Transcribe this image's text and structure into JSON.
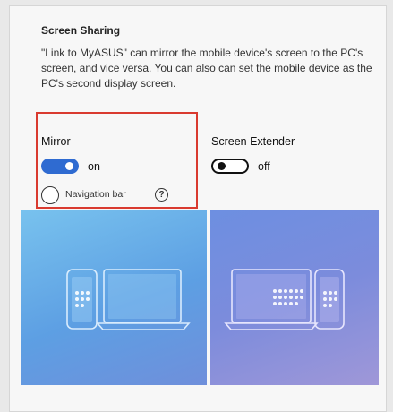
{
  "section": {
    "title": "Screen Sharing",
    "description": "\"Link to MyASUS\" can mirror the mobile device's screen to the PC's screen, and vice versa. You can also can set the mobile device as the PC's second display screen."
  },
  "mirror": {
    "label": "Mirror",
    "toggle_state": "on",
    "navigation_bar_label": "Navigation bar",
    "help_glyph": "?"
  },
  "screen_extender": {
    "label": "Screen Extender",
    "toggle_state": "off"
  },
  "icons": {
    "help": "help-circle-icon",
    "mirror_preview": "phone-laptop-mirror-illustration",
    "extender_preview": "laptop-phone-extend-illustration"
  },
  "colors": {
    "toggle_on": "#2f6bd1",
    "highlight_border": "#d93a2f"
  }
}
